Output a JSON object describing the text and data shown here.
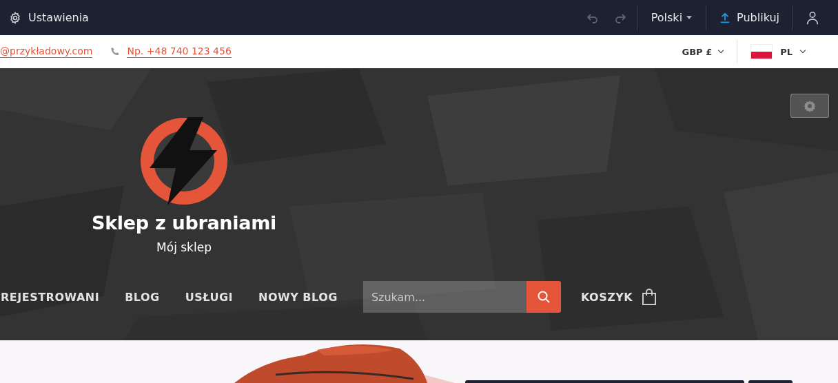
{
  "toolbar": {
    "settings_label": "Ustawienia",
    "language": "Polski",
    "publish_label": "Publikuj"
  },
  "contact": {
    "email": "@przykładowy.com",
    "phone": "Np. +48 740 123 456"
  },
  "currency": "GBP £",
  "language_code": "PL",
  "shop": {
    "title": "Sklep z ubraniami",
    "subtitle": "Mój sklep"
  },
  "nav": [
    "REJESTROWANI",
    "BLOG",
    "USŁUGI",
    "NOWY BLOG"
  ],
  "search": {
    "placeholder": "Szukam..."
  },
  "cart": {
    "label": "KOSZYK"
  }
}
